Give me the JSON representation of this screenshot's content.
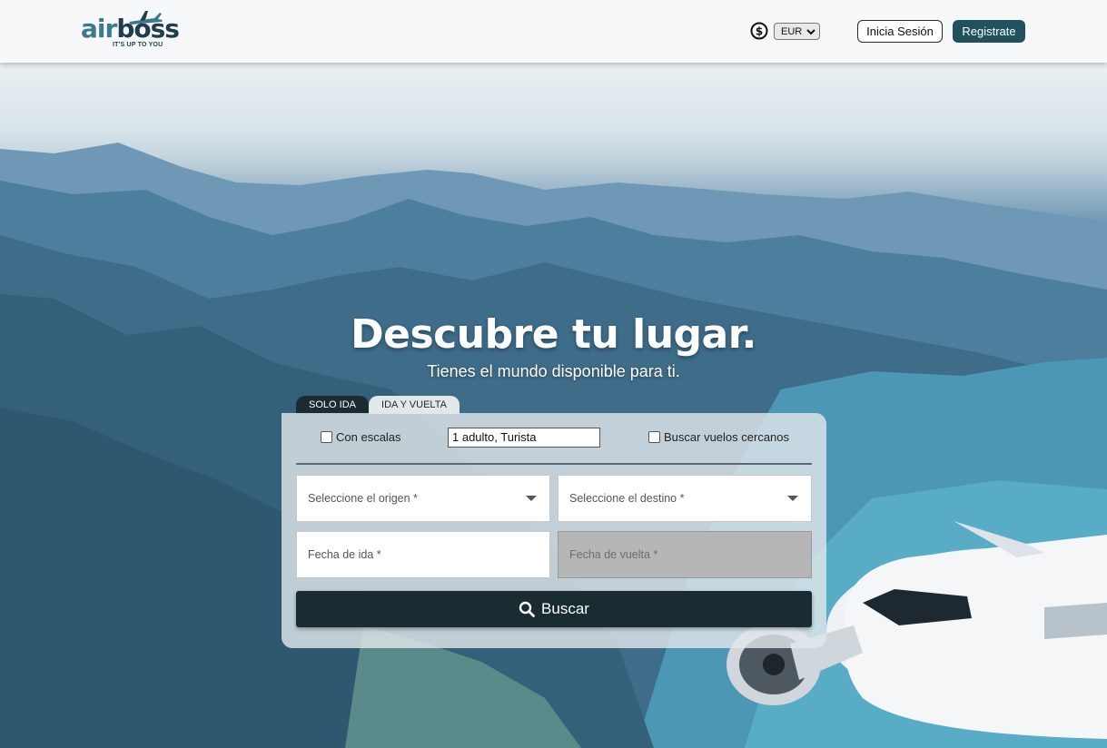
{
  "brand": {
    "name_part1": "air",
    "name_part2": "boss",
    "tagline": "IT'S UP TO YOU"
  },
  "header": {
    "currency_icon": "dollar-circle-icon",
    "currency_value": "EUR",
    "login_label": "Inicia Sesión",
    "register_label": "Registrate"
  },
  "hero": {
    "title": "Descubre tu lugar.",
    "subtitle": "Tienes el mundo disponible para ti."
  },
  "search": {
    "tabs": [
      {
        "label": "SOLO IDA"
      },
      {
        "label": "IDA Y VUELTA"
      }
    ],
    "stops_label": "Con escalas",
    "passengers_value": "1 adulto, Turista",
    "nearby_label": "Buscar vuelos cercanos",
    "origin_placeholder": "Seleccione el origen *",
    "destination_placeholder": "Seleccione el destino *",
    "departure_placeholder": "Fecha de ida *",
    "return_placeholder": "Fecha de vuelta *",
    "search_label": "Buscar"
  },
  "colors": {
    "primary_dark": "#1a2b31",
    "brand_teal": "#21505f",
    "logo_teal": "#3a7a8c"
  }
}
